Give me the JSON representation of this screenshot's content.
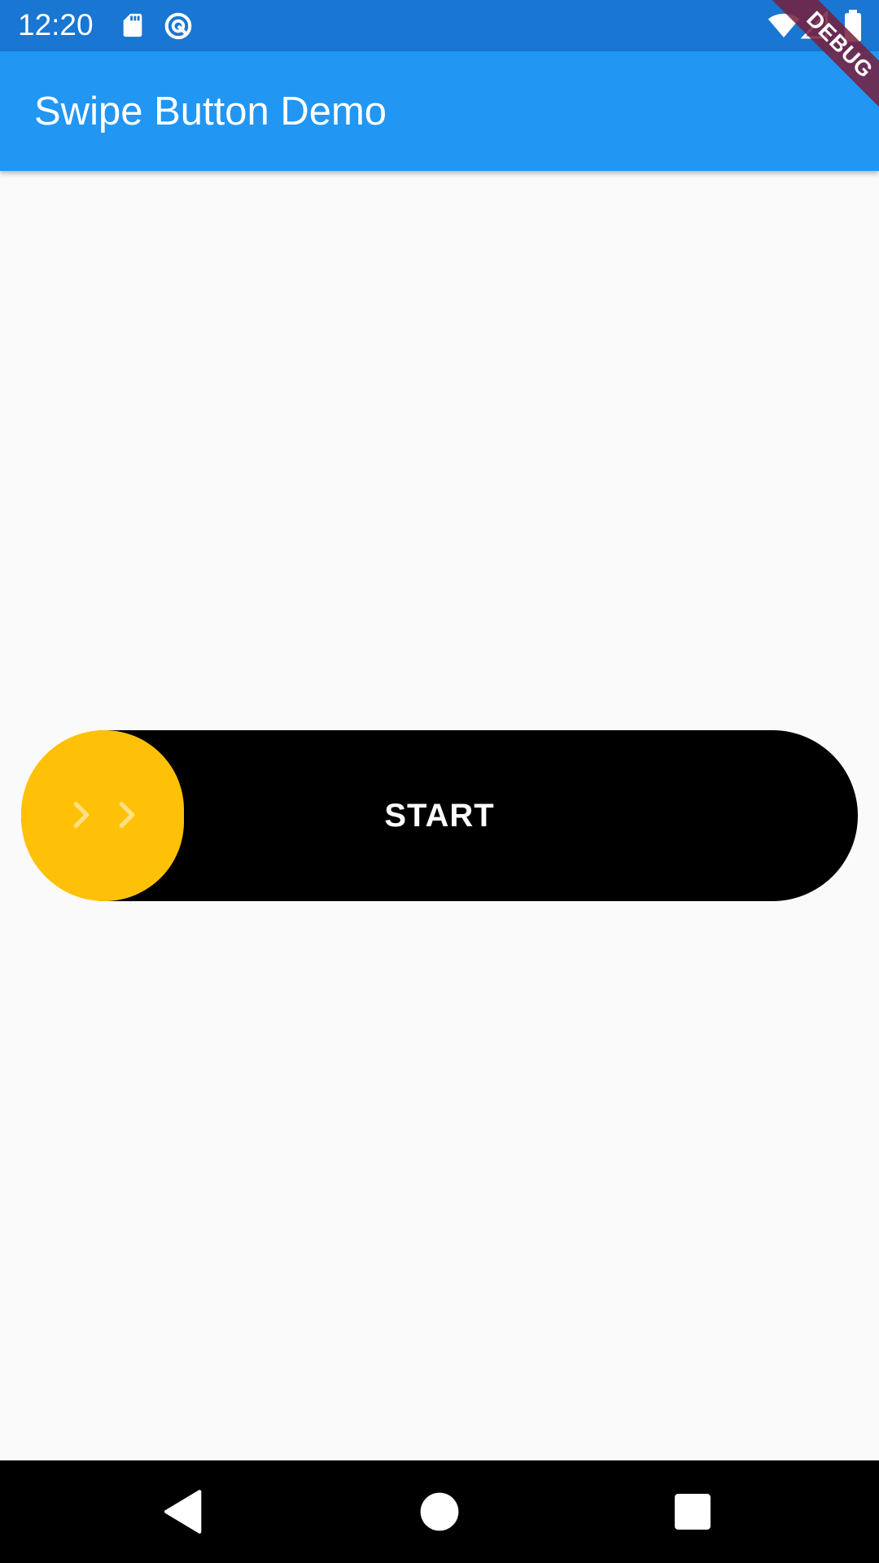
{
  "status_bar": {
    "time": "12:20",
    "icons": [
      "sd-card-icon",
      "sync-disabled-icon",
      "wifi-icon",
      "signal-icon",
      "battery-icon"
    ]
  },
  "app_bar": {
    "title": "Swipe Button Demo",
    "color": "#2196F3"
  },
  "debug_banner": {
    "label": "DEBUG"
  },
  "swipe_button": {
    "label": "START",
    "track_color": "#000000",
    "thumb_color": "#FFC107",
    "thumb_icon": "double-chevron-right-icon"
  },
  "nav_bar": {
    "buttons": [
      "back-icon",
      "home-icon",
      "recents-icon"
    ]
  }
}
